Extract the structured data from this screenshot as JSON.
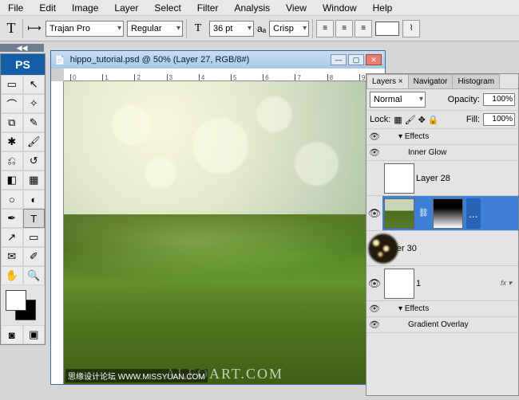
{
  "menu": [
    "File",
    "Edit",
    "Image",
    "Layer",
    "Select",
    "Filter",
    "Analysis",
    "View",
    "Window",
    "Help"
  ],
  "options": {
    "tool_glyph": "T",
    "orient_glyph": "⟼",
    "font_family": "Trajan Pro",
    "font_style": "Regular",
    "size_label": "T",
    "font_size": "36 pt",
    "aa_label": "aₐ",
    "anti_alias": "Crisp"
  },
  "doc": {
    "title": "hippo_tutorial.psd @ 50% (Layer 27, RGB/8#)",
    "ruler_marks": [
      "0",
      "1",
      "2",
      "3",
      "4",
      "5",
      "6",
      "7",
      "8",
      "9"
    ],
    "watermark": "ALFOART.COM",
    "footer_cn": "思缘设计论坛",
    "footer_url": "WWW.MISSYUAN.COM"
  },
  "layers_panel": {
    "tabs": [
      "Layers ×",
      "Navigator",
      "Histogram"
    ],
    "blend_mode": "Normal",
    "opacity_label": "Opacity:",
    "opacity": "100%",
    "lock_label": "Lock:",
    "fill_label": "Fill:",
    "fill": "100%",
    "effects_label": "Effects",
    "inner_glow": "Inner Glow",
    "gradient_overlay": "Gradient Overlay",
    "layers": [
      {
        "name": "Layer 28",
        "thumb": "white",
        "vis": false
      },
      {
        "name": "",
        "thumb": "moss",
        "mask": "grad",
        "vis": true,
        "selected": true,
        "more": "..."
      },
      {
        "name": "Layer 30",
        "thumb": "bokeh",
        "vis": true
      },
      {
        "name": "1",
        "thumb": "white",
        "vis": true,
        "fx": "fx ▾"
      }
    ]
  },
  "ps_logo": "PS",
  "collapse_glyph": "◀◀"
}
